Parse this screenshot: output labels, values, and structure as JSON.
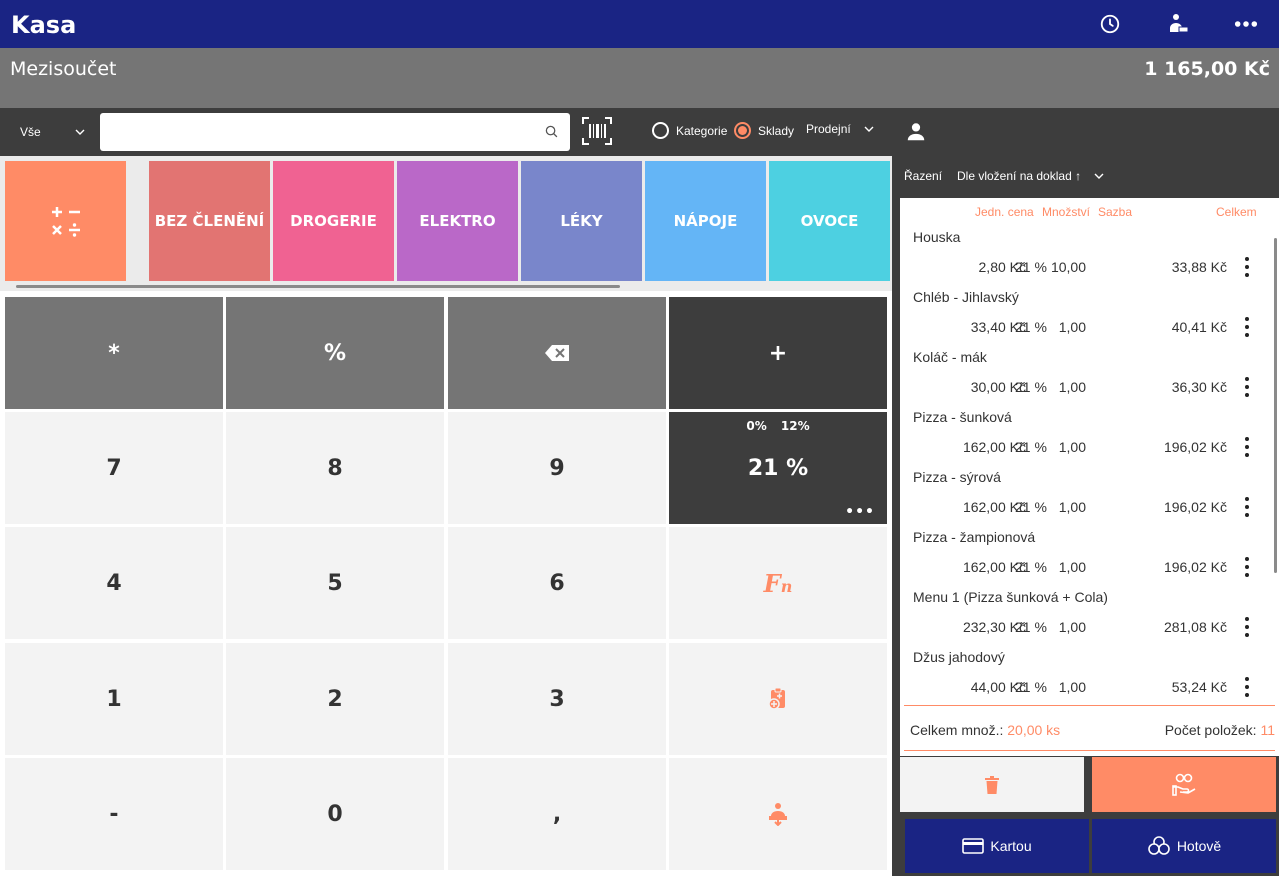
{
  "header": {
    "title": "Kasa",
    "icons": [
      "clock-icon",
      "cashier-icon",
      "more-icon"
    ]
  },
  "subtotal": {
    "label": "Mezisoučet",
    "value": "1 165,00 Kč"
  },
  "toolbar": {
    "filter_value": "Vše",
    "search_value": "",
    "search_placeholder": "",
    "radio_categories": "Kategorie",
    "radio_warehouses": "Sklady",
    "radio_selected": "Sklady",
    "mode_value": "Prodejní"
  },
  "categories": [
    {
      "label": "BEZ ČLENĚNÍ",
      "color": "#e27472"
    },
    {
      "label": "DROGERIE",
      "color": "#f06292"
    },
    {
      "label": "ELEKTRO",
      "color": "#ba68c8"
    },
    {
      "label": "LÉKY",
      "color": "#7986cb"
    },
    {
      "label": "NÁPOJE",
      "color": "#64b5f6"
    },
    {
      "label": "OVOCE",
      "color": "#4dd0e1"
    }
  ],
  "keypad": {
    "multiply": "*",
    "percent": "%",
    "plus": "+",
    "k7": "7",
    "k8": "8",
    "k9": "9",
    "k4": "4",
    "k5": "5",
    "k6": "6",
    "k1": "1",
    "k2": "2",
    "k3": "3",
    "minus": "-",
    "k0": "0",
    "comma": ",",
    "vat_options": [
      "0%",
      "12%"
    ],
    "vat_current": "21 %",
    "fn_main": "F",
    "fn_sub": "n"
  },
  "sort": {
    "label": "Řazení",
    "value": "Dle vložení na doklad ↑"
  },
  "doc_columns": {
    "unit_price": "Jedn. cena",
    "quantity": "Množství",
    "rate": "Sazba",
    "total": "Celkem"
  },
  "items": [
    {
      "name": "Houska",
      "unit_price": "2,80 Kč",
      "qty": "10,00",
      "vat": "21 %",
      "total": "33,88 Kč"
    },
    {
      "name": "Chléb - Jihlavský",
      "unit_price": "33,40 Kč",
      "qty": "1,00",
      "vat": "21 %",
      "total": "40,41 Kč"
    },
    {
      "name": "Koláč - mák",
      "unit_price": "30,00 Kč",
      "qty": "1,00",
      "vat": "21 %",
      "total": "36,30 Kč"
    },
    {
      "name": "Pizza - šunková",
      "unit_price": "162,00 Kč",
      "qty": "1,00",
      "vat": "21 %",
      "total": "196,02 Kč"
    },
    {
      "name": "Pizza - sýrová",
      "unit_price": "162,00 Kč",
      "qty": "1,00",
      "vat": "21 %",
      "total": "196,02 Kč"
    },
    {
      "name": "Pizza - žampionová",
      "unit_price": "162,00 Kč",
      "qty": "1,00",
      "vat": "21 %",
      "total": "196,02 Kč"
    },
    {
      "name": "Menu 1 (Pizza šunková + Cola)",
      "unit_price": "232,30 Kč",
      "qty": "1,00",
      "vat": "21 %",
      "total": "281,08 Kč"
    },
    {
      "name": "Džus jahodový",
      "unit_price": "44,00 Kč",
      "qty": "1,00",
      "vat": "21 %",
      "total": "53,24 Kč"
    }
  ],
  "totals": {
    "qty_label": "Celkem množ.:",
    "qty_value": "20,00 ks",
    "count_label": "Počet položek:",
    "count_value": "11"
  },
  "pay": {
    "card_label": "Kartou",
    "cash_label": "Hotově"
  },
  "colors": {
    "brand": "#1a2484",
    "accent": "#ff8b66",
    "dark": "#3d3d3d",
    "grey": "#757575"
  }
}
